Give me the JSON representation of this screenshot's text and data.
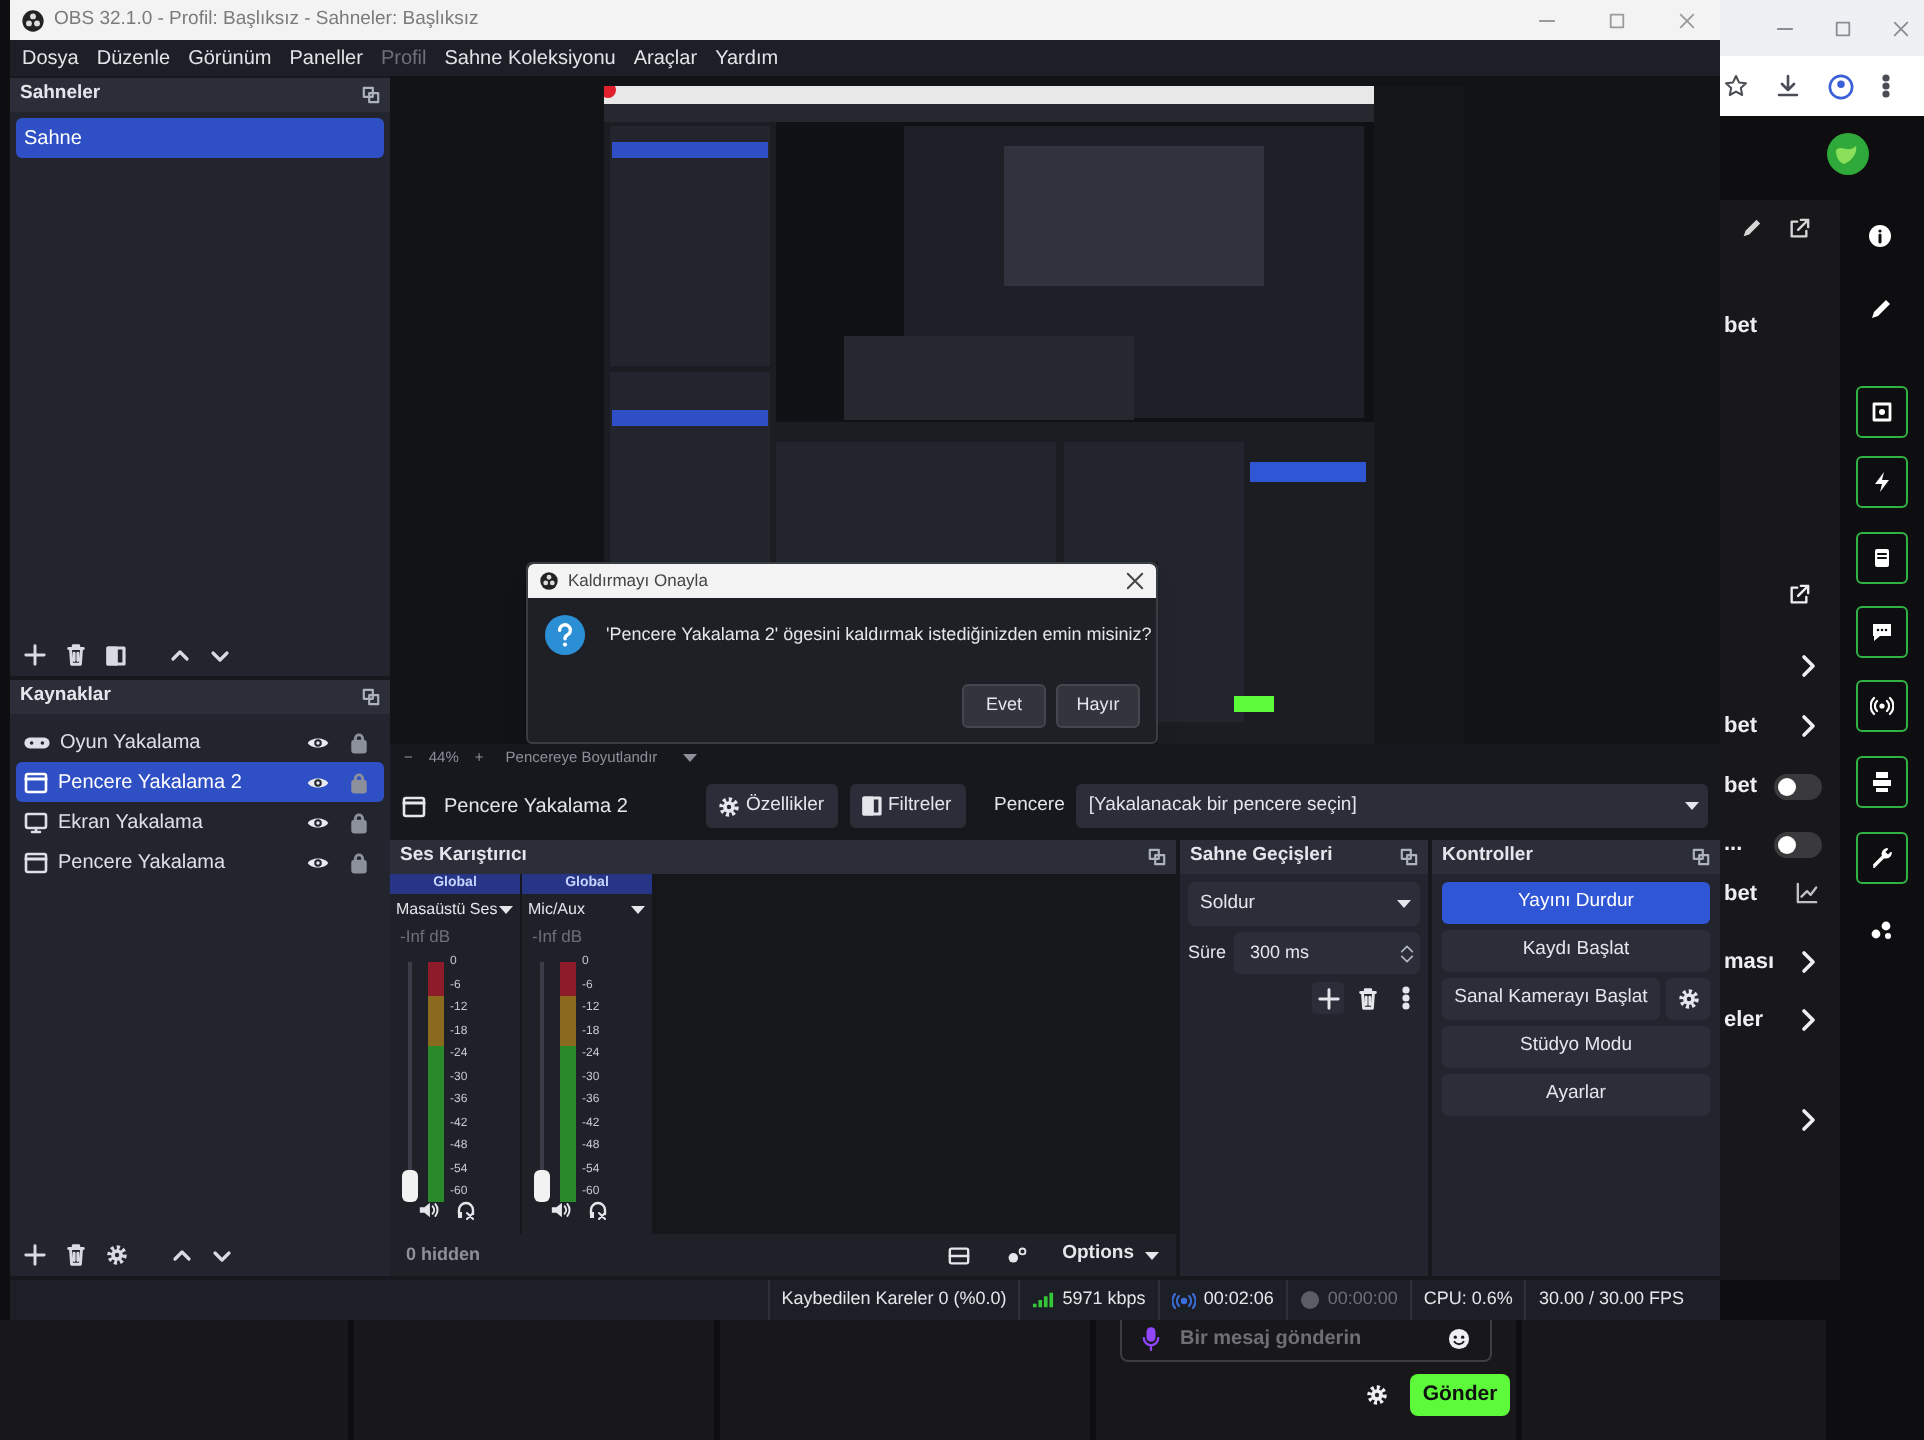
{
  "obs": {
    "title": "OBS 32.1.0 - Profil: Başlıksız - Sahneler: Başlıksız",
    "menu": [
      {
        "label": "Dosya",
        "disabled": false
      },
      {
        "label": "Düzenle",
        "disabled": false
      },
      {
        "label": "Görünüm",
        "disabled": false
      },
      {
        "label": "Paneller",
        "disabled": false
      },
      {
        "label": "Profil",
        "disabled": true
      },
      {
        "label": "Sahne Koleksiyonu",
        "disabled": false
      },
      {
        "label": "Araçlar",
        "disabled": false
      },
      {
        "label": "Yardım",
        "disabled": false
      }
    ],
    "scenes": {
      "title": "Sahneler",
      "items": [
        {
          "label": "Sahne",
          "selected": true
        }
      ]
    },
    "sources": {
      "title": "Kaynaklar",
      "items": [
        {
          "label": "Oyun Yakalama",
          "kind": "game",
          "selected": false
        },
        {
          "label": "Pencere Yakalama 2",
          "kind": "window",
          "selected": true
        },
        {
          "label": "Ekran Yakalama",
          "kind": "display",
          "selected": false
        },
        {
          "label": "Pencere Yakalama",
          "kind": "window",
          "selected": false
        }
      ]
    },
    "preview": {
      "zoom_out": "−",
      "zoom": "44%",
      "zoom_in": "+",
      "fit": "Pencereye Boyutlandır"
    },
    "dialog": {
      "title": "Kaldırmayı Onayla",
      "message": "'Pencere Yakalama 2' ögesini kaldırmak istediğinizden emin misiniz?",
      "buttons": [
        "Evet",
        "Hayır"
      ]
    },
    "source_bar": {
      "name": "Pencere Yakalama 2",
      "buttons": [
        {
          "label": "Özellikler",
          "kind": "properties"
        },
        {
          "label": "Filtreler",
          "kind": "filters"
        }
      ],
      "field_label": "Pencere",
      "field_value": "[Yakalanacak bir pencere seçin]"
    },
    "mixer": {
      "title": "Ses Karıştırıcı",
      "channels": [
        {
          "badge": "Global",
          "name": "Masaüstü Ses",
          "reading": "-Inf dB",
          "level": 0,
          "scale": [
            "0",
            "-6",
            "-12",
            "-18",
            "-24",
            "-30",
            "-36",
            "-42",
            "-48",
            "-54",
            "-60"
          ]
        },
        {
          "badge": "Global",
          "name": "Mic/Aux",
          "reading": "-Inf dB",
          "level": 0,
          "scale": [
            "0",
            "-6",
            "-12",
            "-18",
            "-24",
            "-30",
            "-36",
            "-42",
            "-48",
            "-54",
            "-60"
          ]
        }
      ],
      "hidden": "0 hidden",
      "options": "Options"
    },
    "transitions": {
      "title": "Sahne Geçişleri",
      "transition": "Soldur",
      "duration_label": "Süre",
      "duration": "300 ms"
    },
    "controls": {
      "title": "Kontroller",
      "buttons": [
        {
          "label": "Yayını Durdur",
          "active": true,
          "settings": false
        },
        {
          "label": "Kaydı Başlat",
          "active": false,
          "settings": false
        },
        {
          "label": "Sanal Kamerayı Başlat",
          "active": false,
          "settings": true
        },
        {
          "label": "Stüdyo Modu",
          "active": false,
          "settings": false
        },
        {
          "label": "Ayarlar",
          "active": false,
          "settings": false
        }
      ]
    },
    "status": {
      "dropped": "Kaybedilen Kareler 0 (%0.0)",
      "bitrate": "5971 kbps",
      "stream_time": "00:02:06",
      "record_time": "00:00:00",
      "cpu": "CPU: 0.6%",
      "fps": "30.00 / 30.00 FPS"
    }
  },
  "browser": {
    "rows": [
      {
        "label": "bet",
        "kind": "text"
      },
      {
        "kind": "share"
      },
      {
        "kind": "chevron"
      },
      {
        "label": "bet",
        "kind": "chevron"
      },
      {
        "label": "bet",
        "kind": "toggle",
        "on": false
      },
      {
        "label": "...",
        "kind": "toggle",
        "on": false
      },
      {
        "label": "bet",
        "kind": "chart"
      },
      {
        "label": "ması",
        "kind": "chevron"
      },
      {
        "label": "eler",
        "kind": "chevron"
      },
      {
        "kind": "chevron"
      }
    ],
    "chat": {
      "placeholder": "Bir mesaj gönderin",
      "send": "Gönder"
    }
  }
}
